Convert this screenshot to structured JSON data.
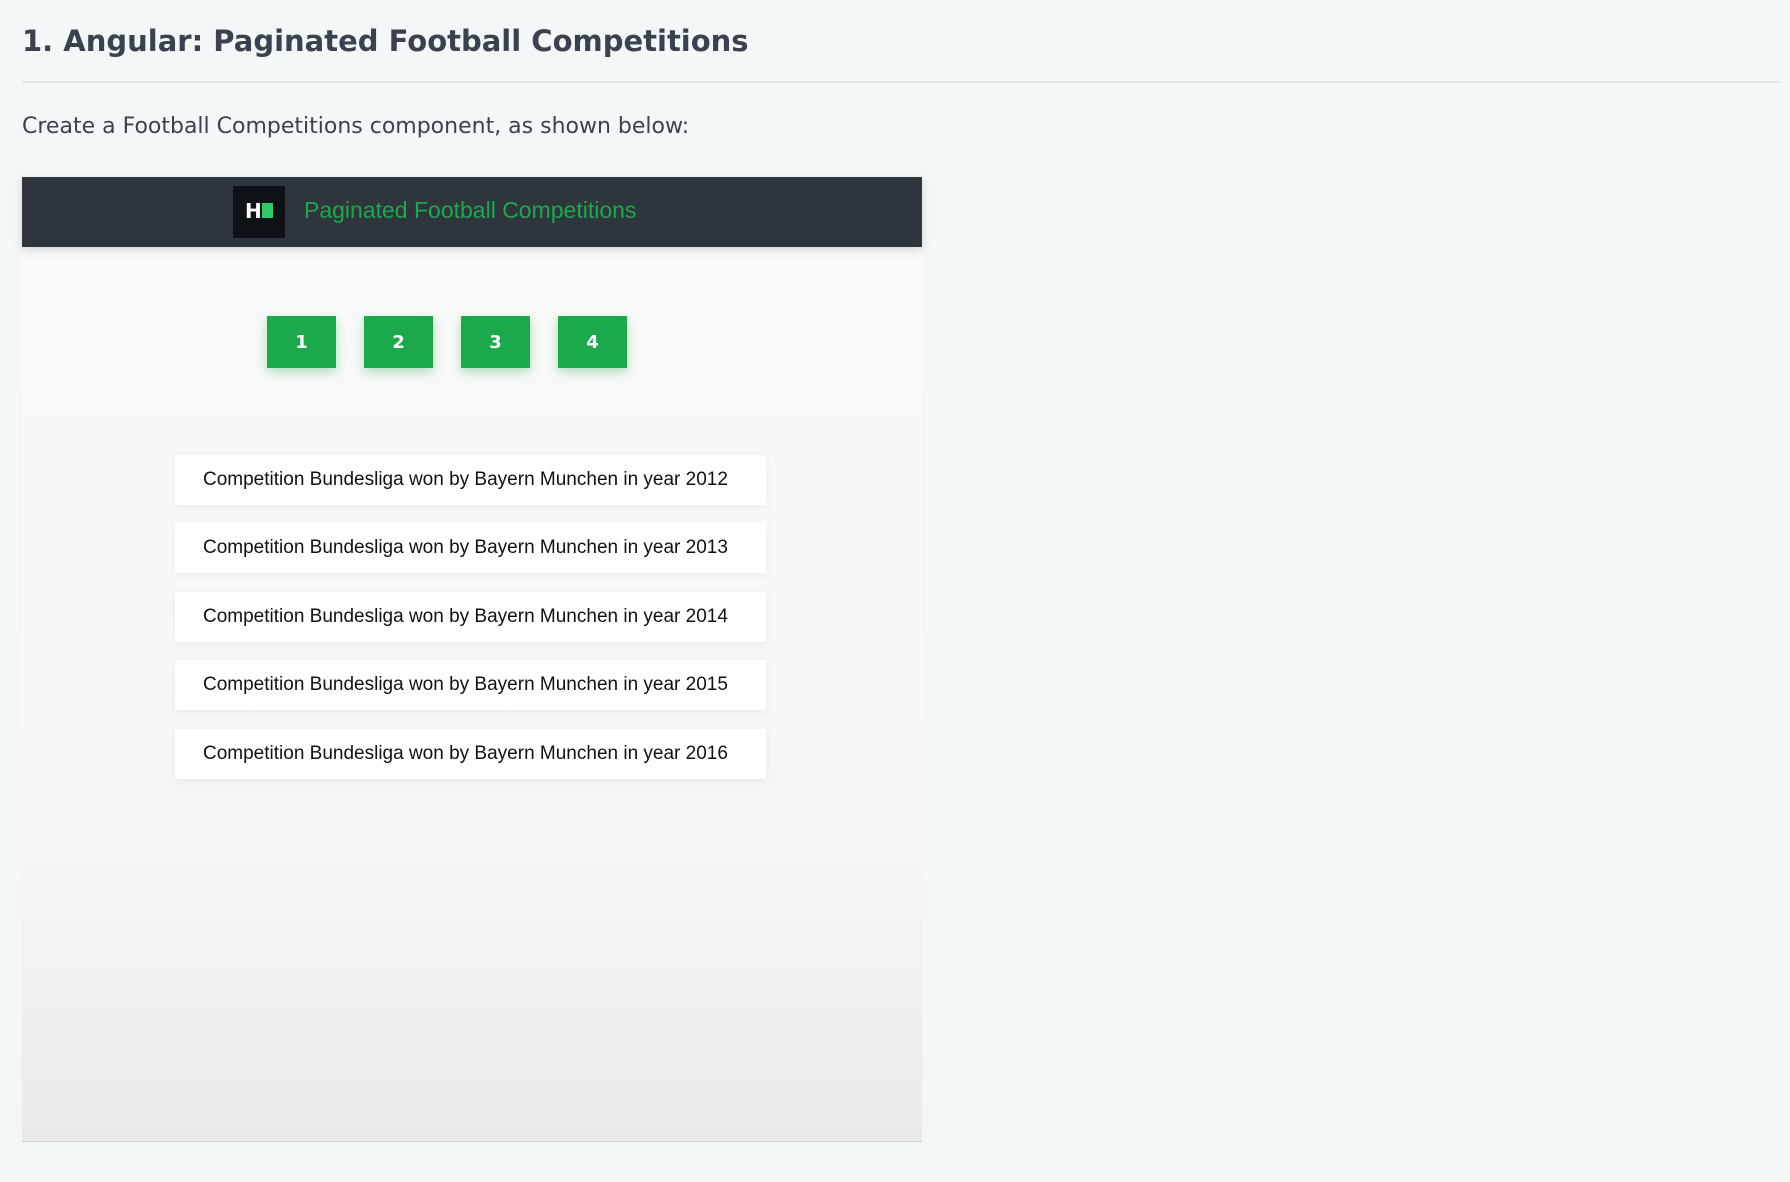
{
  "page": {
    "title": "1. Angular: Paginated Football Competitions",
    "intro": "Create a Football Competitions component, as shown below:"
  },
  "app": {
    "logo_letter": "H",
    "title": "Paginated Football Competitions",
    "accent_color": "#1ba94c",
    "pages": [
      "1",
      "2",
      "3",
      "4"
    ],
    "competitions": [
      "Competition Bundesliga won by Bayern Munchen in year 2012",
      "Competition Bundesliga won by Bayern Munchen in year 2013",
      "Competition Bundesliga won by Bayern Munchen in year 2014",
      "Competition Bundesliga won by Bayern Munchen in year 2015",
      "Competition Bundesliga won by Bayern Munchen in year 2016"
    ]
  }
}
